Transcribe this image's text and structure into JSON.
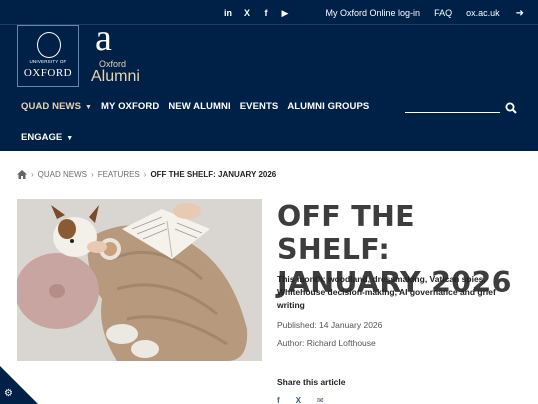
{
  "utility": {
    "social": [
      "in",
      "X",
      "f",
      "▶"
    ],
    "login": "My Oxford Online log-in",
    "faq": "FAQ",
    "site": "ox.ac.uk"
  },
  "brand": {
    "university_of": "UNIVERSITY OF",
    "oxford": "OXFORD",
    "alumni_letter": "a",
    "alumni_oxford": "Oxford",
    "alumni_word": "Alumni"
  },
  "nav": {
    "items": [
      "QUAD NEWS",
      "MY OXFORD",
      "NEW ALUMNI",
      "EVENTS",
      "ALUMNI GROUPS"
    ],
    "second_row": "ENGAGE"
  },
  "breadcrumb": {
    "items": [
      "QUAD NEWS",
      "FEATURES"
    ],
    "current": "OFF THE SHELF: JANUARY 2026"
  },
  "article": {
    "title": "OFF THE SHELF: JANUARY 2026",
    "summary": "This month: woodland, dressmaking, Vatican spies, Whitehouse decision-making, AI governance and grief writing",
    "published": "Published: 14 January 2026",
    "author": "Author: Richard Lofthouse",
    "share_heading": "Share this article",
    "share_icons": [
      "f",
      "X",
      "✉"
    ]
  },
  "colors": {
    "navy": "#002147",
    "gold_accent": "#e8d2b0"
  }
}
